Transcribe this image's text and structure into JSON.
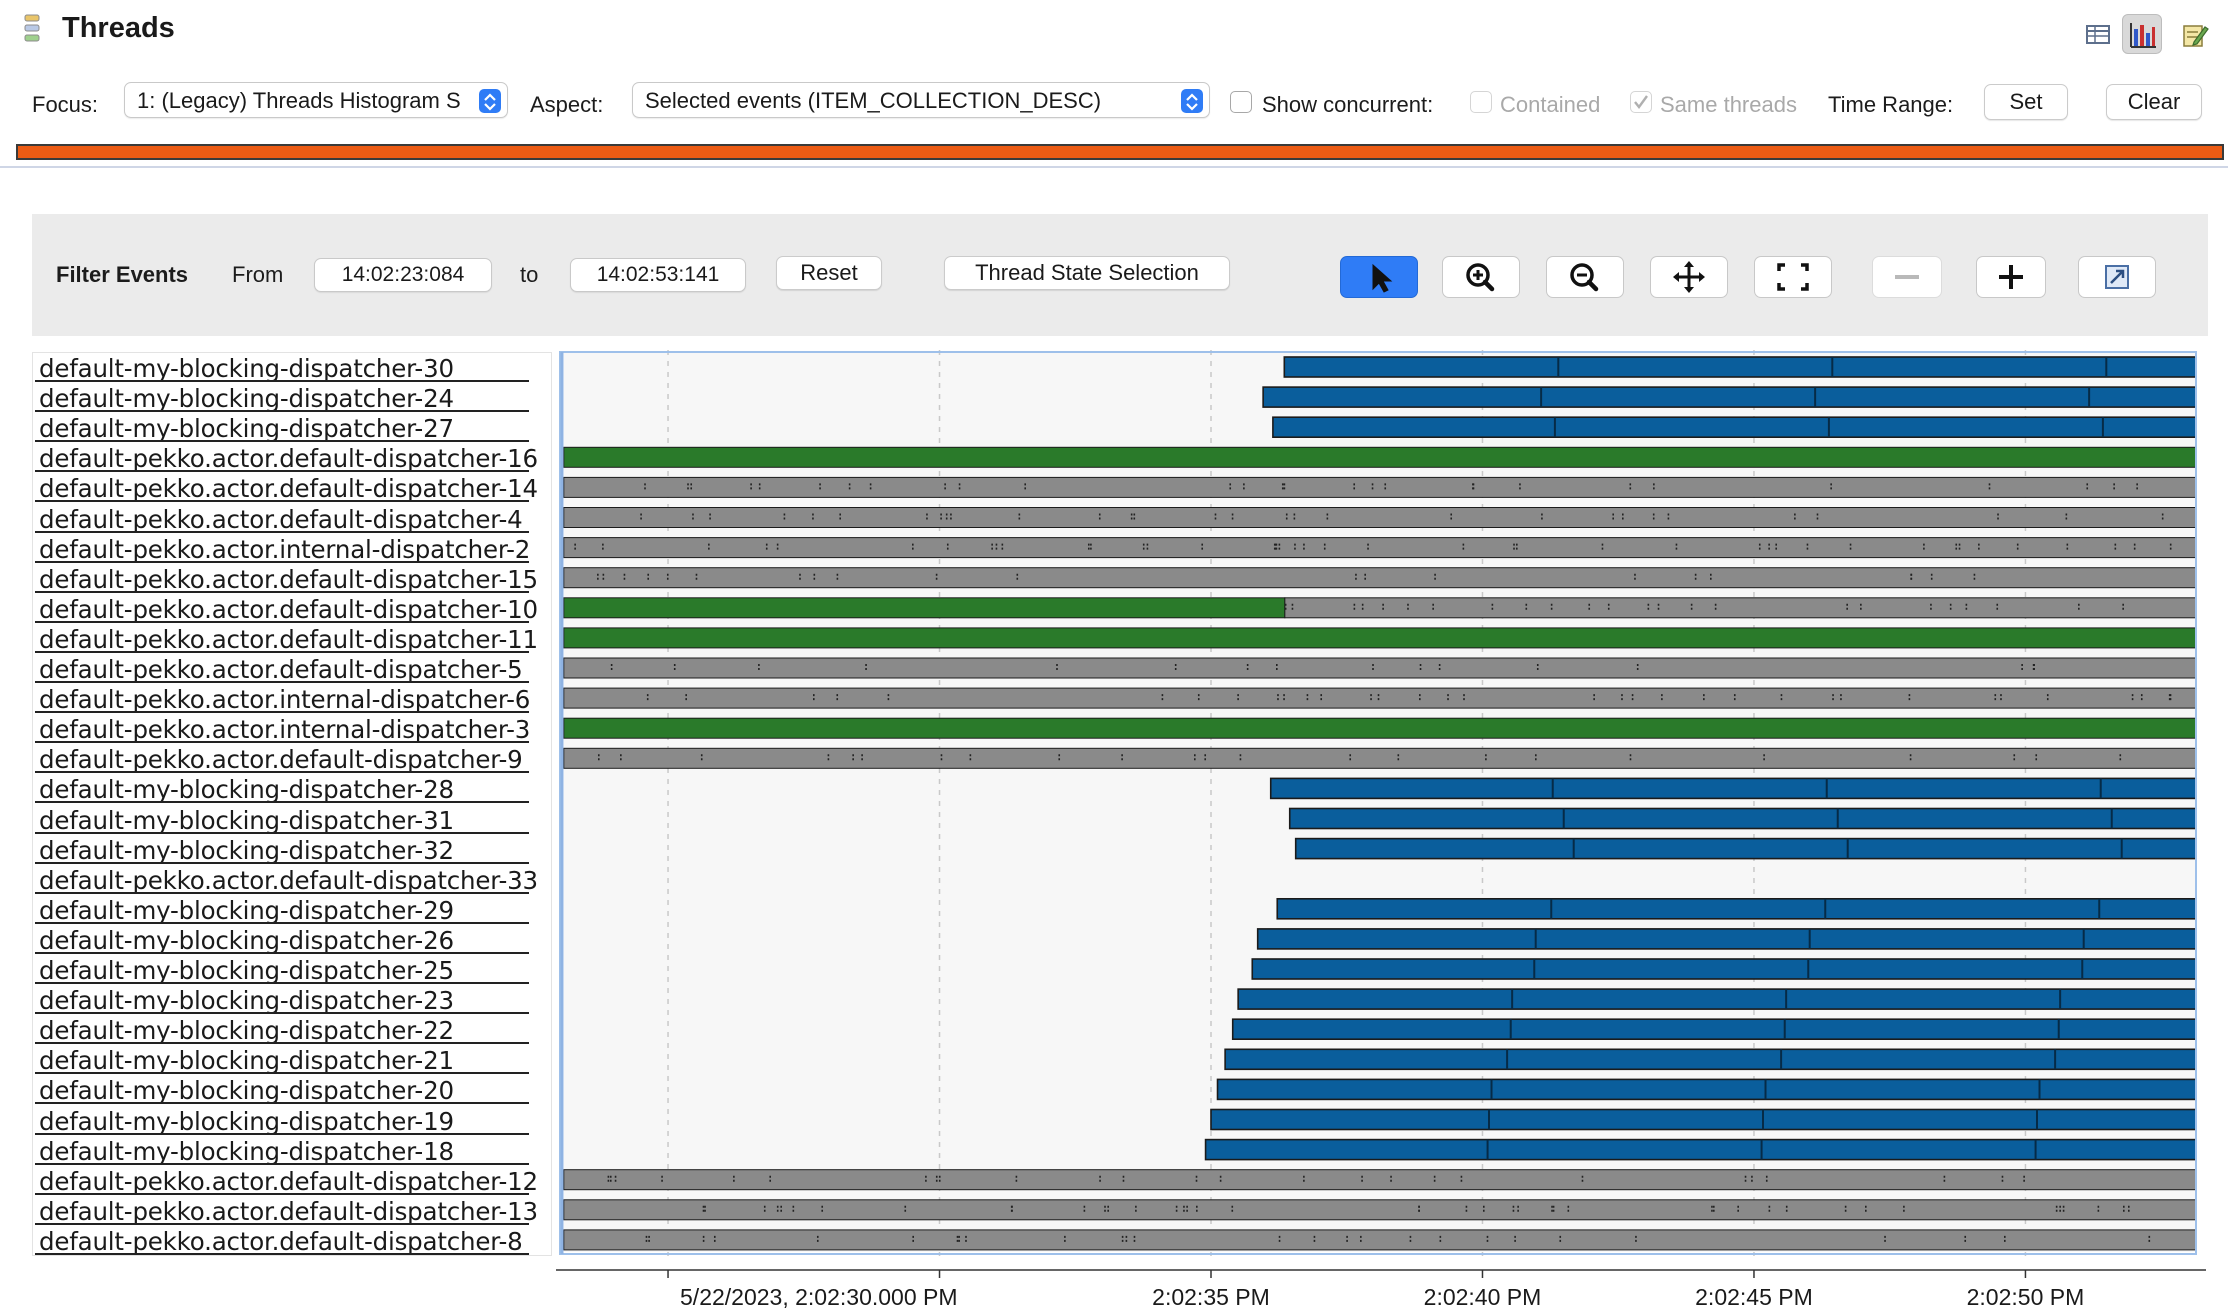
{
  "header": {
    "title": "Threads",
    "icon": "threads-icon"
  },
  "view_buttons": [
    {
      "name": "table-view-icon"
    },
    {
      "name": "chart-view-icon"
    },
    {
      "name": "edit-icon"
    }
  ],
  "toolbar": {
    "focus_label": "Focus:",
    "focus_value": "1: (Legacy) Threads Histogram S",
    "aspect_label": "Aspect:",
    "aspect_value": "Selected events (ITEM_COLLECTION_DESC)",
    "show_concurrent_label": "Show concurrent:",
    "show_concurrent_checked": false,
    "contained_label": "Contained",
    "contained_checked": false,
    "same_threads_label": "Same threads",
    "same_threads_checked": true,
    "time_range_label": "Time Range:",
    "set_label": "Set",
    "clear_label": "Clear",
    "progress_color": "#ec5b14"
  },
  "filter": {
    "title": "Filter Events",
    "from_label": "From",
    "from_value": "14:02:23:084",
    "to_label": "to",
    "to_value": "14:02:53:141",
    "reset_label": "Reset",
    "thread_state_label": "Thread State Selection",
    "tools": [
      {
        "name": "select-pointer-icon",
        "active": true
      },
      {
        "name": "zoom-in-icon",
        "active": false
      },
      {
        "name": "zoom-out-icon",
        "active": false
      },
      {
        "name": "pan-move-icon",
        "active": false
      },
      {
        "name": "fit-screen-icon",
        "active": false
      },
      {
        "name": "minus-icon",
        "active": false,
        "disabled": true
      },
      {
        "name": "plus-icon",
        "active": false
      },
      {
        "name": "export-icon",
        "active": false
      }
    ]
  },
  "colors": {
    "running": "#2a7a2a",
    "waiting": "#8a8a8a",
    "blocked": "#0a5e9c",
    "accent": "#2f7cf6"
  },
  "threads": [
    {
      "name": "default-my-blocking-dispatcher-30",
      "start": 36.35,
      "state": "blocked"
    },
    {
      "name": "default-my-blocking-dispatcher-24",
      "start": 35.96,
      "state": "blocked"
    },
    {
      "name": "default-my-blocking-dispatcher-27",
      "start": 36.14,
      "state": "blocked"
    },
    {
      "name": "default-pekko.actor.default-dispatcher-16",
      "start": 23.08,
      "state": "running"
    },
    {
      "name": "default-pekko.actor.default-dispatcher-14",
      "start": 23.08,
      "state": "waiting"
    },
    {
      "name": "default-pekko.actor.default-dispatcher-4",
      "start": 23.08,
      "state": "waiting"
    },
    {
      "name": "default-pekko.actor.internal-dispatcher-2",
      "start": 23.08,
      "state": "waiting"
    },
    {
      "name": "default-pekko.actor.default-dispatcher-15",
      "start": 23.08,
      "state": "waiting"
    },
    {
      "name": "default-pekko.actor.default-dispatcher-10",
      "start": 23.08,
      "state": "running",
      "switch_to": "waiting",
      "switch_at": 36.36
    },
    {
      "name": "default-pekko.actor.default-dispatcher-11",
      "start": 23.08,
      "state": "running"
    },
    {
      "name": "default-pekko.actor.default-dispatcher-5",
      "start": 23.08,
      "state": "waiting"
    },
    {
      "name": "default-pekko.actor.internal-dispatcher-6",
      "start": 23.08,
      "state": "waiting"
    },
    {
      "name": "default-pekko.actor.internal-dispatcher-3",
      "start": 23.08,
      "state": "running"
    },
    {
      "name": "default-pekko.actor.default-dispatcher-9",
      "start": 23.08,
      "state": "waiting"
    },
    {
      "name": "default-my-blocking-dispatcher-28",
      "start": 36.1,
      "state": "blocked"
    },
    {
      "name": "default-my-blocking-dispatcher-31",
      "start": 36.45,
      "state": "blocked"
    },
    {
      "name": "default-my-blocking-dispatcher-32",
      "start": 36.56,
      "state": "blocked"
    },
    {
      "name": "default-pekko.actor.default-dispatcher-33",
      "start": null,
      "state": "none"
    },
    {
      "name": "default-my-blocking-dispatcher-29",
      "start": 36.22,
      "state": "blocked"
    },
    {
      "name": "default-my-blocking-dispatcher-26",
      "start": 35.86,
      "state": "blocked"
    },
    {
      "name": "default-my-blocking-dispatcher-25",
      "start": 35.76,
      "state": "blocked"
    },
    {
      "name": "default-my-blocking-dispatcher-23",
      "start": 35.5,
      "state": "blocked"
    },
    {
      "name": "default-my-blocking-dispatcher-22",
      "start": 35.4,
      "state": "blocked"
    },
    {
      "name": "default-my-blocking-dispatcher-21",
      "start": 35.26,
      "state": "blocked"
    },
    {
      "name": "default-my-blocking-dispatcher-20",
      "start": 35.12,
      "state": "blocked"
    },
    {
      "name": "default-my-blocking-dispatcher-19",
      "start": 35.0,
      "state": "blocked"
    },
    {
      "name": "default-my-blocking-dispatcher-18",
      "start": 34.9,
      "state": "blocked"
    },
    {
      "name": "default-pekko.actor.default-dispatcher-12",
      "start": 23.08,
      "state": "waiting"
    },
    {
      "name": "default-pekko.actor.default-dispatcher-13",
      "start": 23.08,
      "state": "waiting"
    },
    {
      "name": "default-pekko.actor.default-dispatcher-8",
      "start": 23.08,
      "state": "waiting"
    }
  ],
  "time_axis": {
    "range_seconds": [
      23.084,
      53.141
    ],
    "ticks": [
      {
        "t": 30,
        "label": "5/22/2023, 2:02:30.000 PM"
      },
      {
        "t": 35,
        "label": "2:02:35 PM"
      },
      {
        "t": 40,
        "label": "2:02:40 PM"
      },
      {
        "t": 45,
        "label": "2:02:45 PM"
      },
      {
        "t": 50,
        "label": "2:02:50 PM"
      }
    ]
  }
}
